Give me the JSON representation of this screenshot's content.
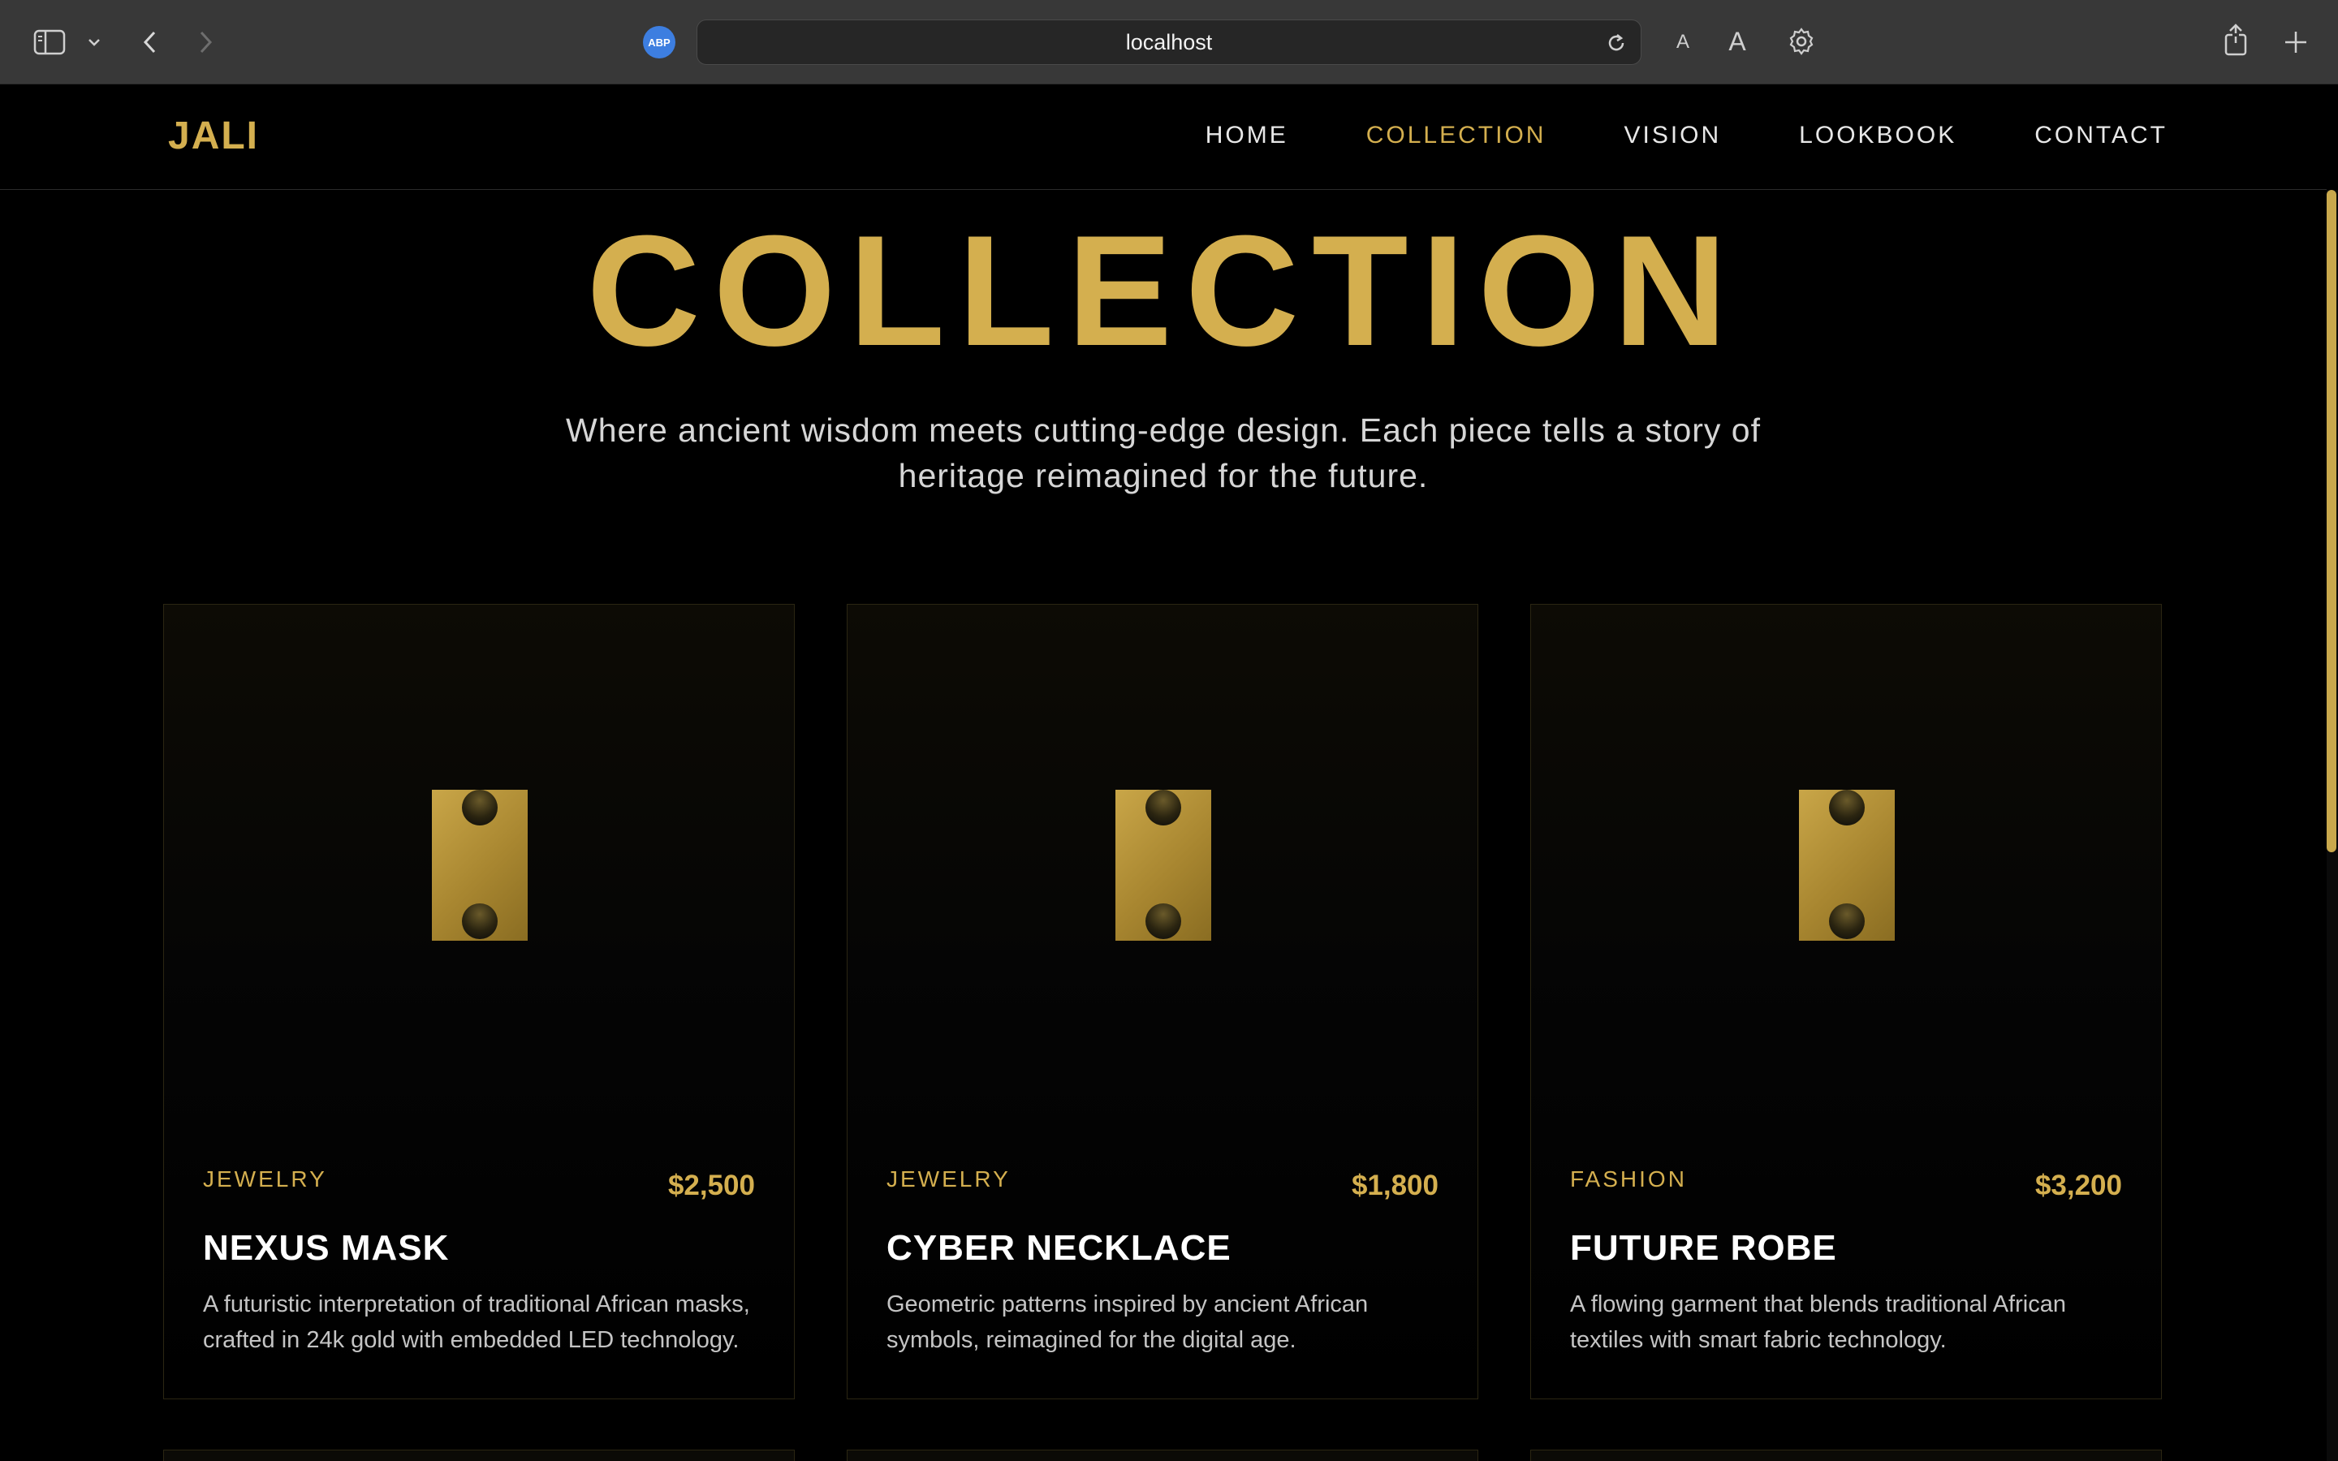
{
  "browser": {
    "url": "localhost",
    "abp_label": "ABP",
    "font_small": "A",
    "font_large": "A",
    "icons": [
      "sidebar-icon",
      "chevron-down-icon",
      "back-icon",
      "forward-icon",
      "reload-icon",
      "gear-icon",
      "share-icon",
      "plus-icon"
    ]
  },
  "header": {
    "logo": "JALI",
    "nav": [
      {
        "label": "HOME",
        "active": false
      },
      {
        "label": "COLLECTION",
        "active": true
      },
      {
        "label": "VISION",
        "active": false
      },
      {
        "label": "LOOKBOOK",
        "active": false
      },
      {
        "label": "CONTACT",
        "active": false
      }
    ]
  },
  "hero": {
    "title": "COLLECTION",
    "subtitle_line1": "Where ancient wisdom meets cutting-edge design. Each piece tells a story of",
    "subtitle_line2": "heritage reimagined for the future."
  },
  "products": [
    {
      "category": "JEWELRY",
      "price": "$2,500",
      "name": "NEXUS MASK",
      "description_line1": "A futuristic interpretation of traditional African masks,",
      "description_line2": "crafted in 24k gold with embedded LED technology."
    },
    {
      "category": "JEWELRY",
      "price": "$1,800",
      "name": "CYBER NECKLACE",
      "description_line1": "Geometric patterns inspired by ancient African",
      "description_line2": "symbols, reimagined for the digital age."
    },
    {
      "category": "FASHION",
      "price": "$3,200",
      "name": "FUTURE ROBE",
      "description_line1": "A flowing garment that blends traditional African",
      "description_line2": "textiles with smart fabric technology."
    }
  ],
  "colors": {
    "gold": "#d4af4f",
    "background": "#000000",
    "chrome": "#383838"
  }
}
